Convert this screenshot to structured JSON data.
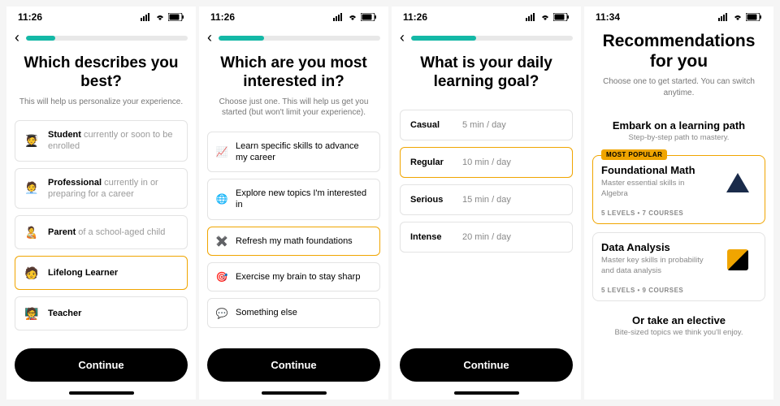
{
  "screens": [
    {
      "time": "11:26",
      "progress": 0.18,
      "title": "Which describes you best?",
      "subtitle": "This will help us personalize your experience.",
      "cta": "Continue",
      "selectedIndex": 3,
      "options": [
        {
          "icon": "student-icon",
          "glyph": "🧑‍🎓",
          "bold": "Student",
          "rest": " currently or soon to be enrolled"
        },
        {
          "icon": "professional-icon",
          "glyph": "🧑‍💼",
          "bold": "Professional",
          "rest": " currently in or preparing for a career"
        },
        {
          "icon": "parent-icon",
          "glyph": "🧑‍🍼",
          "bold": "Parent",
          "rest": " of a school-aged child"
        },
        {
          "icon": "learner-icon",
          "glyph": "🧑",
          "bold": "Lifelong Learner",
          "rest": ""
        },
        {
          "icon": "teacher-icon",
          "glyph": "🧑‍🏫",
          "bold": "Teacher",
          "rest": ""
        }
      ]
    },
    {
      "time": "11:26",
      "progress": 0.28,
      "title": "Which are you most interested in?",
      "subtitle": "Choose just one. This will help us get you started (but won't limit your experience).",
      "cta": "Continue",
      "selectedIndex": 2,
      "options": [
        {
          "icon": "trend-icon",
          "glyph": "📈",
          "text": "Learn specific skills to advance my career"
        },
        {
          "icon": "globe-icon",
          "glyph": "🌐",
          "text": "Explore new topics I'm interested in"
        },
        {
          "icon": "math-icon",
          "glyph": "✖️",
          "text": "Refresh my math foundations"
        },
        {
          "icon": "target-icon",
          "glyph": "🎯",
          "text": "Exercise my brain to stay sharp"
        },
        {
          "icon": "ellipsis-icon",
          "glyph": "💬",
          "text": "Something else"
        }
      ]
    },
    {
      "time": "11:26",
      "progress": 0.4,
      "title": "What is your daily learning goal?",
      "subtitle": "",
      "cta": "Continue",
      "selectedIndex": 1,
      "goals": [
        {
          "name": "Casual",
          "value": "5 min / day"
        },
        {
          "name": "Regular",
          "value": "10 min / day"
        },
        {
          "name": "Serious",
          "value": "15 min / day"
        },
        {
          "name": "Intense",
          "value": "20 min / day"
        }
      ]
    },
    {
      "time": "11:34",
      "title": "Recommendations for you",
      "subtitle": "Choose one to get started. You can switch anytime.",
      "section1": {
        "title": "Embark on a learning path",
        "subtitle": "Step-by-step path to mastery."
      },
      "section2": {
        "title": "Or take an elective",
        "subtitle": "Bite-sized topics we think you'll enjoy."
      },
      "badge": "MOST POPULAR",
      "selectedIndex": 0,
      "cards": [
        {
          "title": "Foundational Math",
          "desc": "Master essential skills in Algebra",
          "meta": "5 LEVELS • 7 COURSES"
        },
        {
          "title": "Data Analysis",
          "desc": "Master key skills in probability and data analysis",
          "meta": "5 LEVELS • 9 COURSES"
        }
      ]
    }
  ]
}
